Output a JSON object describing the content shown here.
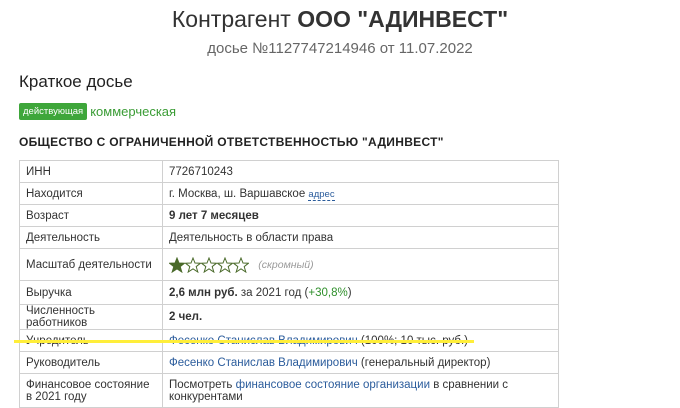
{
  "header": {
    "title_prefix": "Контрагент",
    "title_name": "ООО \"АДИНВЕСТ\"",
    "subtitle": "досье №1127747214946 от 11.07.2022"
  },
  "section_title": "Краткое досье",
  "badges": {
    "status": "действующая",
    "type": "коммерческая"
  },
  "full_name": "ОБЩЕСТВО С ОГРАНИЧЕННОЙ ОТВЕТСТВЕННОСТЬЮ \"АДИНВЕСТ\"",
  "rows": {
    "inn": {
      "label": "ИНН",
      "value": "7726710243"
    },
    "location": {
      "label": "Находится",
      "value": "г. Москва, ш. Варшавское",
      "link": "адрес"
    },
    "age": {
      "label": "Возраст",
      "value": "9 лет 7 месяцев"
    },
    "activity": {
      "label": "Деятельность",
      "value": "Деятельность в области права"
    },
    "scale": {
      "label": "Масштаб деятельности",
      "rating": 1,
      "max": 5,
      "note": "(скромный)"
    },
    "revenue": {
      "label": "Выручка",
      "value": "2,6 млн руб.",
      "period": "за 2021 год",
      "change_open": "(",
      "change": "+30,8%",
      "change_close": ")"
    },
    "employees": {
      "label": "Численность работников",
      "value": "2 чел."
    },
    "founder": {
      "label": "Учредитель",
      "name": "Фесенко Станислав Владимирович",
      "details": "(100%; 10 тыс. руб.)"
    },
    "director": {
      "label": "Руководитель",
      "name": "Фесенко Станислав Владимирович",
      "details": "(генеральный директор)"
    },
    "finance": {
      "label": "Финансовое состояние в 2021 году",
      "text_before": "Посмотреть",
      "link": "финансовое состояние организации",
      "text_after": "в сравнении с конкурентами"
    }
  },
  "colors": {
    "badge_green": "#3ea63a",
    "link_blue": "#2b5c9c",
    "star": "#4a6a2a",
    "highlight": "#ffee3a"
  }
}
